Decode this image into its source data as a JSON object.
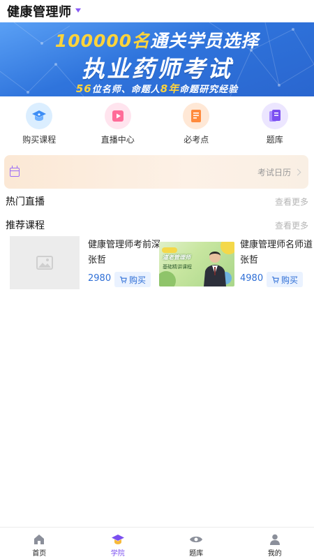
{
  "header": {
    "title": "健康管理师"
  },
  "banner": {
    "line1_number": "100000名",
    "line1_text": "通关学员选择",
    "line2": "执业药师考试",
    "line3_a": "56",
    "line3_b": "位名师、",
    "line3_c": "命题人",
    "line3_d": "8年",
    "line3_e": "命题研究经验"
  },
  "quicknav": {
    "items": [
      {
        "label": "购买课程",
        "icon": "graduation-cap-icon"
      },
      {
        "label": "直播中心",
        "icon": "play-icon"
      },
      {
        "label": "必考点",
        "icon": "notebook-icon"
      },
      {
        "label": "题库",
        "icon": "question-bank-icon"
      }
    ]
  },
  "calendar": {
    "label": "考试日历"
  },
  "sections": {
    "live": {
      "title": "热门直播",
      "more": "查看更多"
    },
    "recommended": {
      "title": "推荐课程",
      "more": "查看更多"
    }
  },
  "courses": [
    {
      "title": "健康管理师考前深张哲",
      "price": "2980",
      "buy": "购买"
    },
    {
      "title": "健康管理师名师道张哲",
      "price": "4980",
      "buy": "购买"
    }
  ],
  "course_thumb": {
    "line1": "道老管理师",
    "line2": "基础精讲课程"
  },
  "tabbar": {
    "items": [
      {
        "label": "首页"
      },
      {
        "label": "学院"
      },
      {
        "label": "题库"
      },
      {
        "label": "我的"
      }
    ],
    "active_index": 1,
    "active_color": "#7b4ff0"
  }
}
